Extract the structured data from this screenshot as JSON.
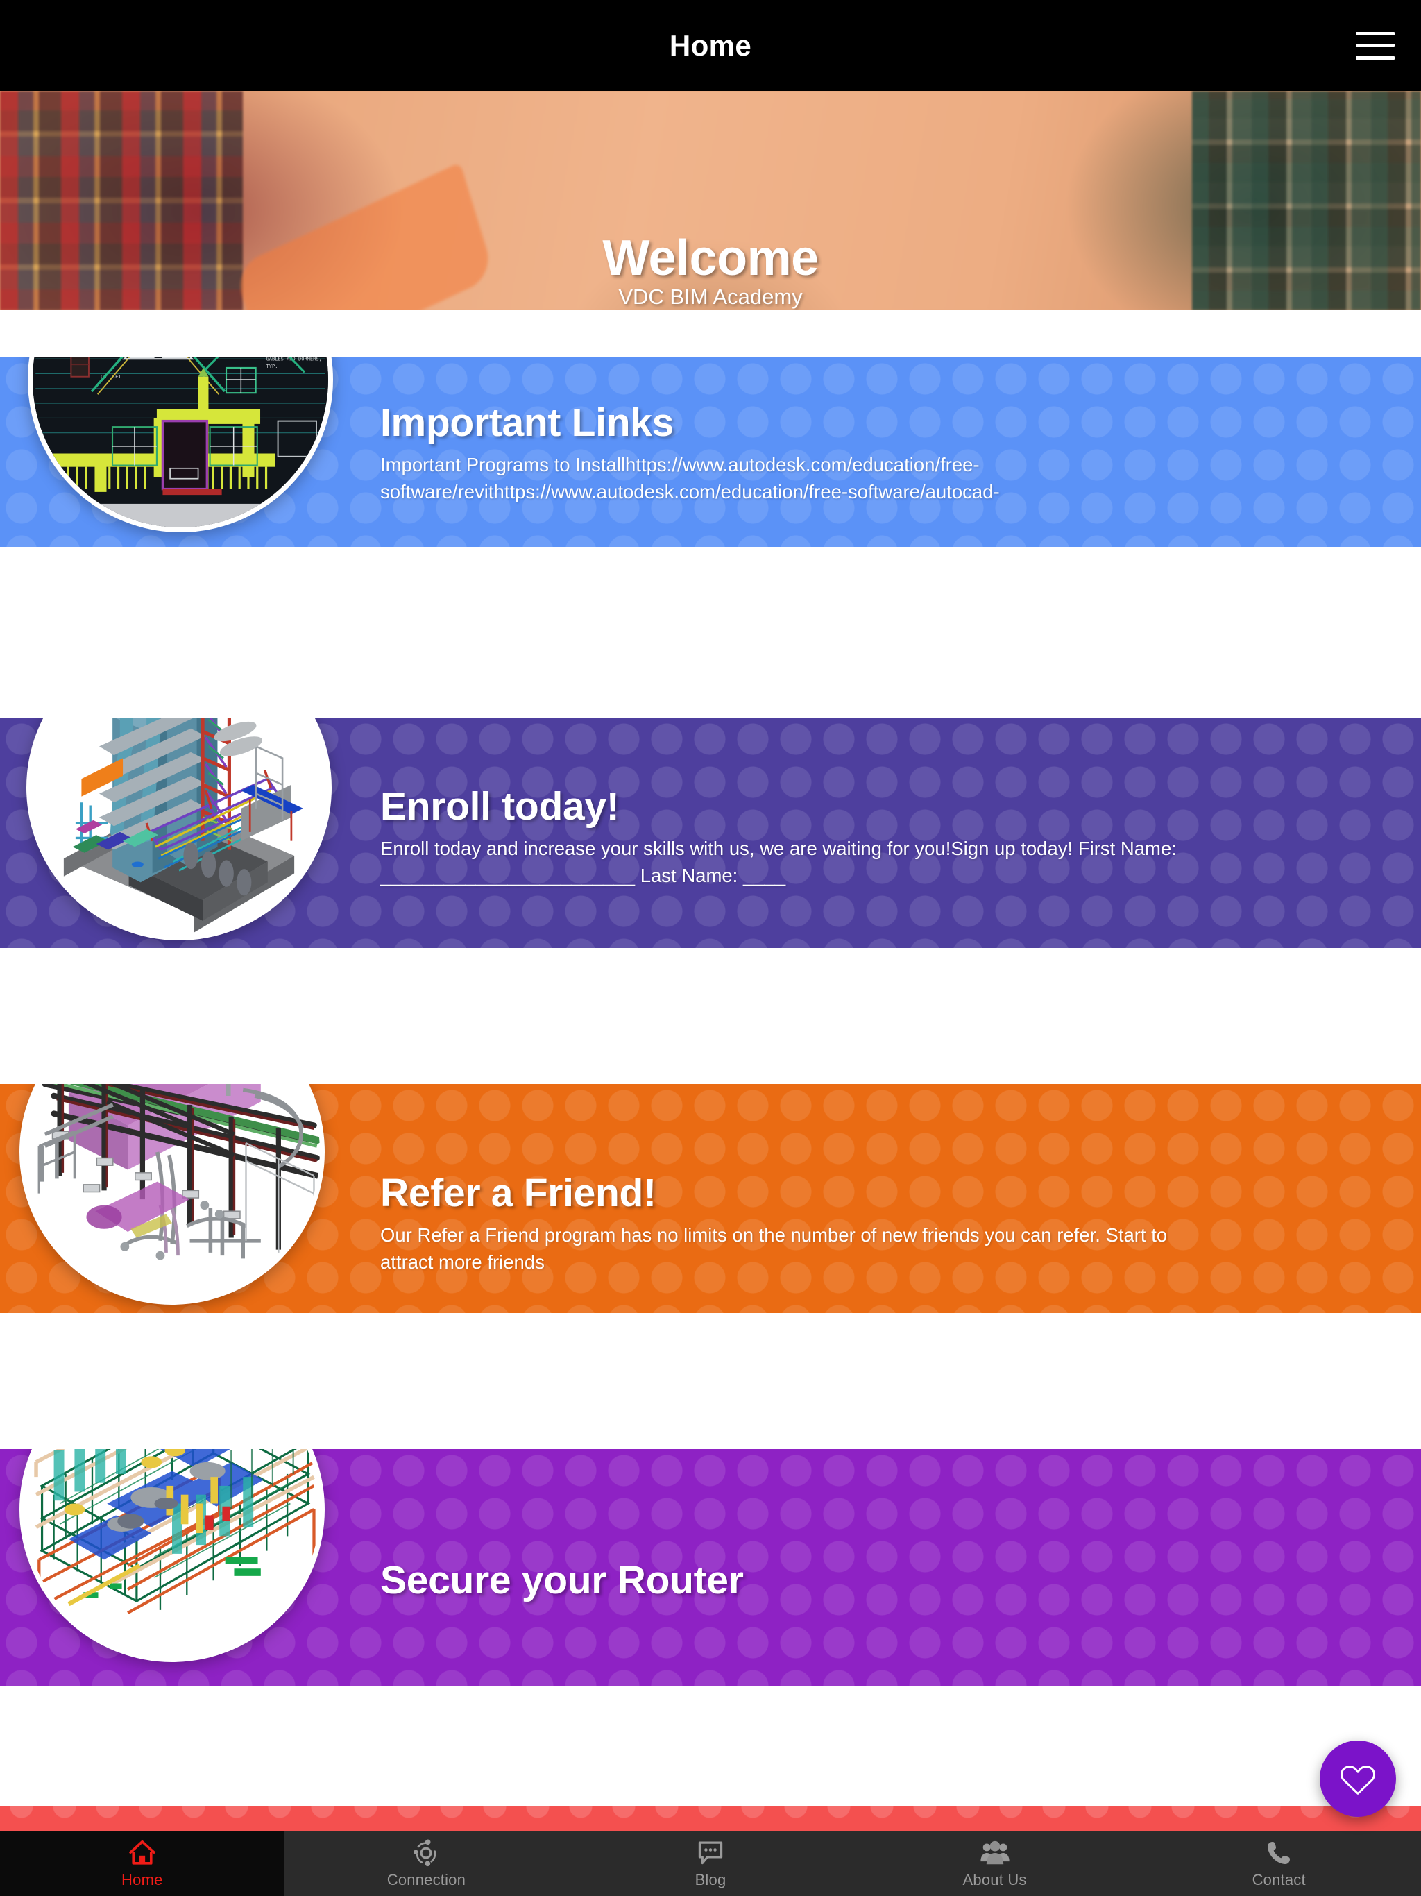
{
  "topbar": {
    "title": "Home",
    "menu_icon": "hamburger-menu-icon"
  },
  "hero": {
    "title": "Welcome",
    "subtitle": "VDC BIM Academy"
  },
  "cards": [
    {
      "title": "Important Links",
      "description": "Important Programs to Installhttps://www.autodesk.com/education/free-software/revithttps://www.autodesk.com/education/free-software/autocad-",
      "color": "#5b92f7",
      "thumb_icon": "autocad-house-elevation-thumbnail"
    },
    {
      "title": "Enroll today!",
      "description": "Enroll today and increase your skills with us, we are waiting for you!Sign up today! First Name: ________________________ Last Name: ____",
      "color": "#4e3f9e",
      "thumb_icon": "industrial-plant-bim-model-thumbnail"
    },
    {
      "title": "Refer a Friend!",
      "description": "Our Refer a Friend program has no limits on the number of new friends you can refer. Start to attract more friends",
      "color": "#ea6b13",
      "thumb_icon": "piping-rack-bim-model-thumbnail"
    },
    {
      "title": "Secure your Router",
      "description": "",
      "color": "#8e22c4",
      "thumb_icon": "structural-steel-bim-model-thumbnail"
    }
  ],
  "fab": {
    "icon": "heart-icon",
    "color": "#7b13c9"
  },
  "bottom_nav": {
    "active_color": "#ef1c17",
    "inactive_color": "#9b9b9b",
    "items": [
      {
        "label": "Home",
        "icon": "home-icon",
        "active": true
      },
      {
        "label": "Connection",
        "icon": "connection-network-icon",
        "active": false
      },
      {
        "label": "Blog",
        "icon": "chat-bubble-icon",
        "active": false
      },
      {
        "label": "About Us",
        "icon": "people-group-icon",
        "active": false
      },
      {
        "label": "Contact",
        "icon": "phone-icon",
        "active": false
      }
    ]
  }
}
